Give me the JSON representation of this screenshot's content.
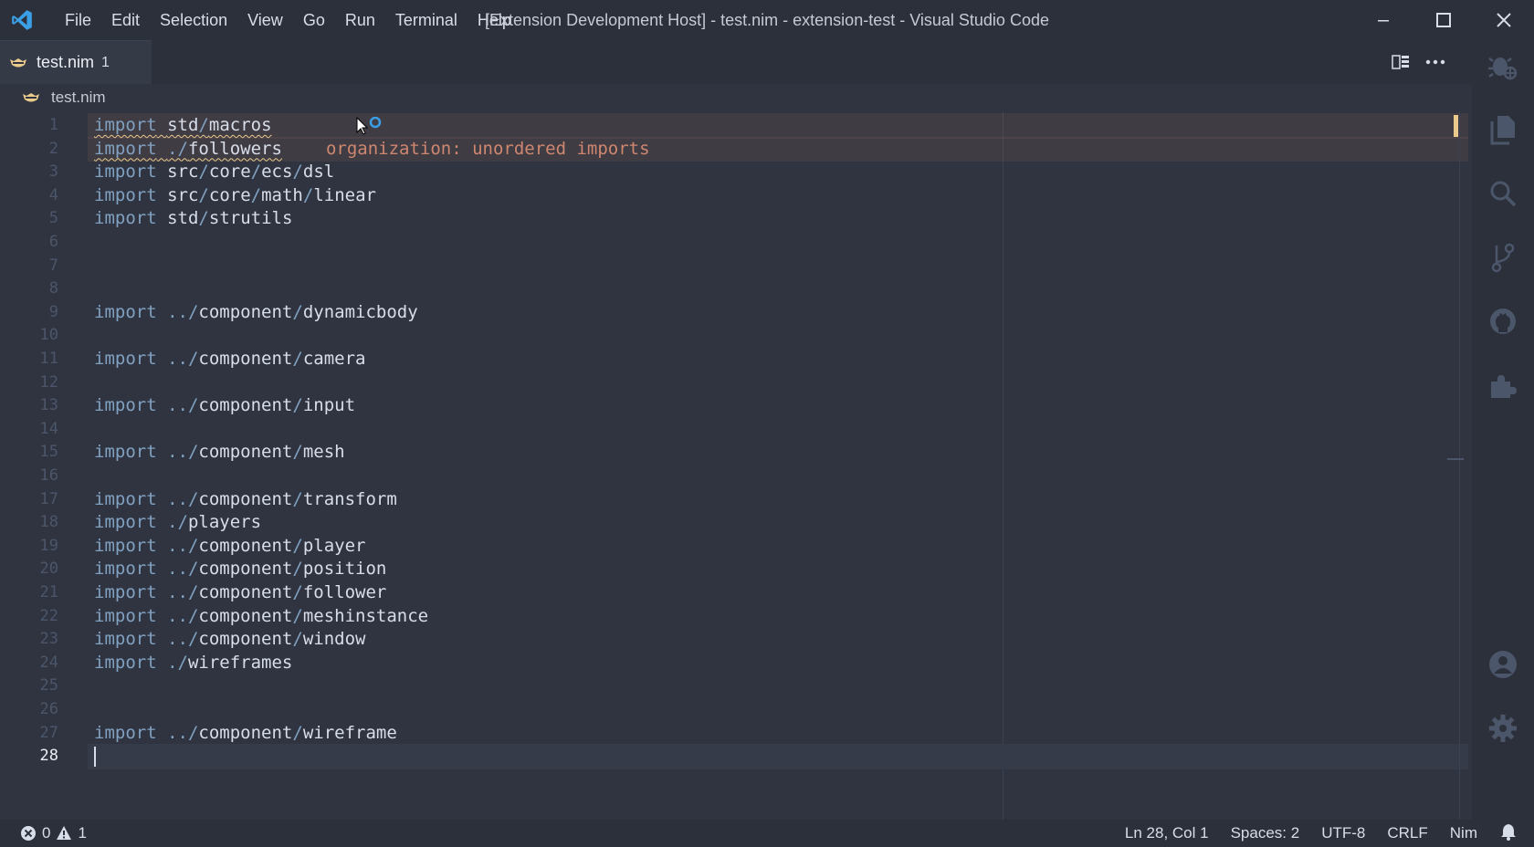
{
  "window": {
    "title": "[Extension Development Host] - test.nim - extension-test - Visual Studio Code"
  },
  "menu": [
    "File",
    "Edit",
    "Selection",
    "View",
    "Go",
    "Run",
    "Terminal",
    "Help"
  ],
  "tab": {
    "label": "test.nim",
    "badge": "1"
  },
  "breadcrumb": {
    "file": "test.nim"
  },
  "editor": {
    "active_line": 28,
    "diagnostic": "organization: unordered imports",
    "lines": [
      "import std/macros",
      "import ./followers",
      "import src/core/ecs/dsl",
      "import src/core/math/linear",
      "import std/strutils",
      "",
      "",
      "",
      "import ../component/dynamicbody",
      "",
      "import ../component/camera",
      "",
      "import ../component/input",
      "",
      "import ../component/mesh",
      "",
      "import ../component/transform",
      "import ./players",
      "import ../component/player",
      "import ../component/position",
      "import ../component/follower",
      "import ../component/meshinstance",
      "import ../component/window",
      "import ./wireframes",
      "",
      "",
      "import ../component/wireframe",
      ""
    ]
  },
  "activity_icons": [
    "debug-icon",
    "explorer-icon",
    "search-icon",
    "source-control-icon",
    "github-icon",
    "extensions-icon",
    "account-icon",
    "settings-gear-icon"
  ],
  "status": {
    "errors": "0",
    "warnings": "1",
    "position": "Ln 28, Col 1",
    "spaces": "Spaces: 2",
    "encoding": "UTF-8",
    "eol": "CRLF",
    "language": "Nim"
  },
  "colors": {
    "keyword": "#81a1c1",
    "warning": "#ebcb8b",
    "diagnostic": "#d08770",
    "background": "#2f3440"
  }
}
